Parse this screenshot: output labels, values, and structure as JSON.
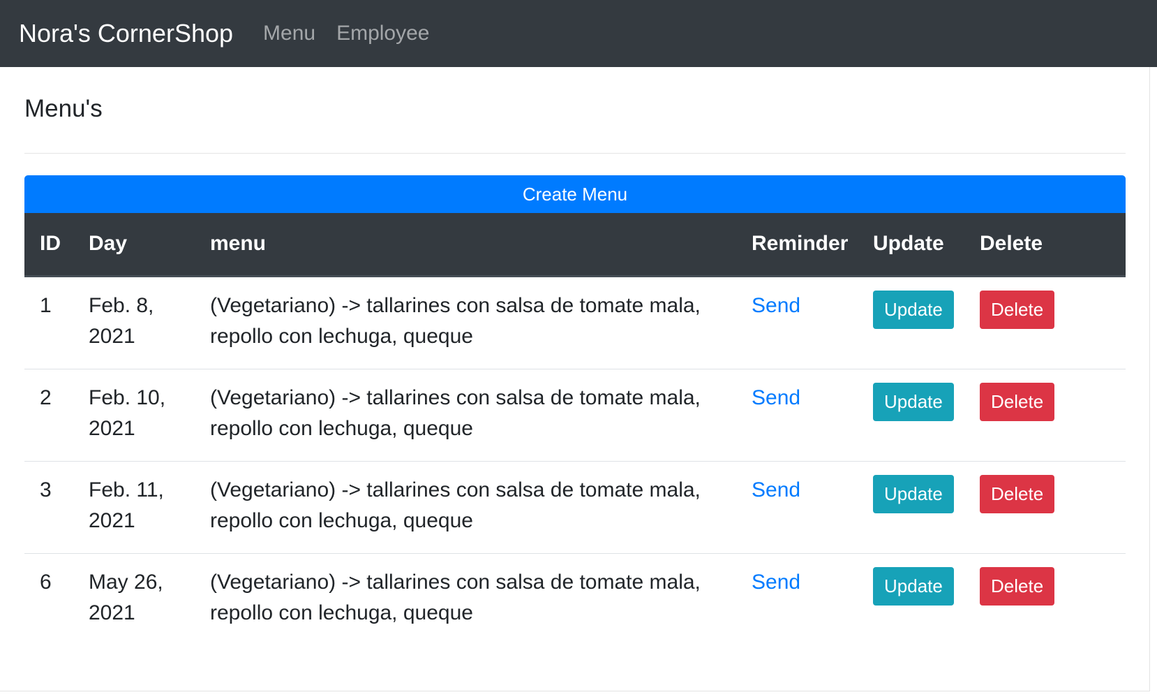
{
  "navbar": {
    "brand": "Nora's CornerShop",
    "links": [
      "Menu",
      "Employee"
    ]
  },
  "page": {
    "title": "Menu's",
    "create_button": "Create Menu"
  },
  "colors": {
    "navbar_bg": "#343a40",
    "primary": "#007bff",
    "info": "#17a2b8",
    "danger": "#dc3545"
  },
  "table": {
    "headers": [
      "ID",
      "Day",
      "menu",
      "Reminder",
      "Update",
      "Delete"
    ],
    "rows": [
      {
        "id": "1",
        "day": "Feb. 8, 2021",
        "menu": "(Vegetariano) -> tallarines con salsa de tomate mala, repollo con lechuga, queque",
        "reminder": "Send",
        "update": "Update",
        "delete": "Delete"
      },
      {
        "id": "2",
        "day": "Feb. 10, 2021",
        "menu": "(Vegetariano) -> tallarines con salsa de tomate mala, repollo con lechuga, queque",
        "reminder": "Send",
        "update": "Update",
        "delete": "Delete"
      },
      {
        "id": "3",
        "day": "Feb. 11, 2021",
        "menu": "(Vegetariano) -> tallarines con salsa de tomate mala, repollo con lechuga, queque",
        "reminder": "Send",
        "update": "Update",
        "delete": "Delete"
      },
      {
        "id": "6",
        "day": "May 26, 2021",
        "menu": "(Vegetariano) -> tallarines con salsa de tomate mala, repollo con lechuga, queque",
        "reminder": "Send",
        "update": "Update",
        "delete": "Delete"
      }
    ]
  }
}
